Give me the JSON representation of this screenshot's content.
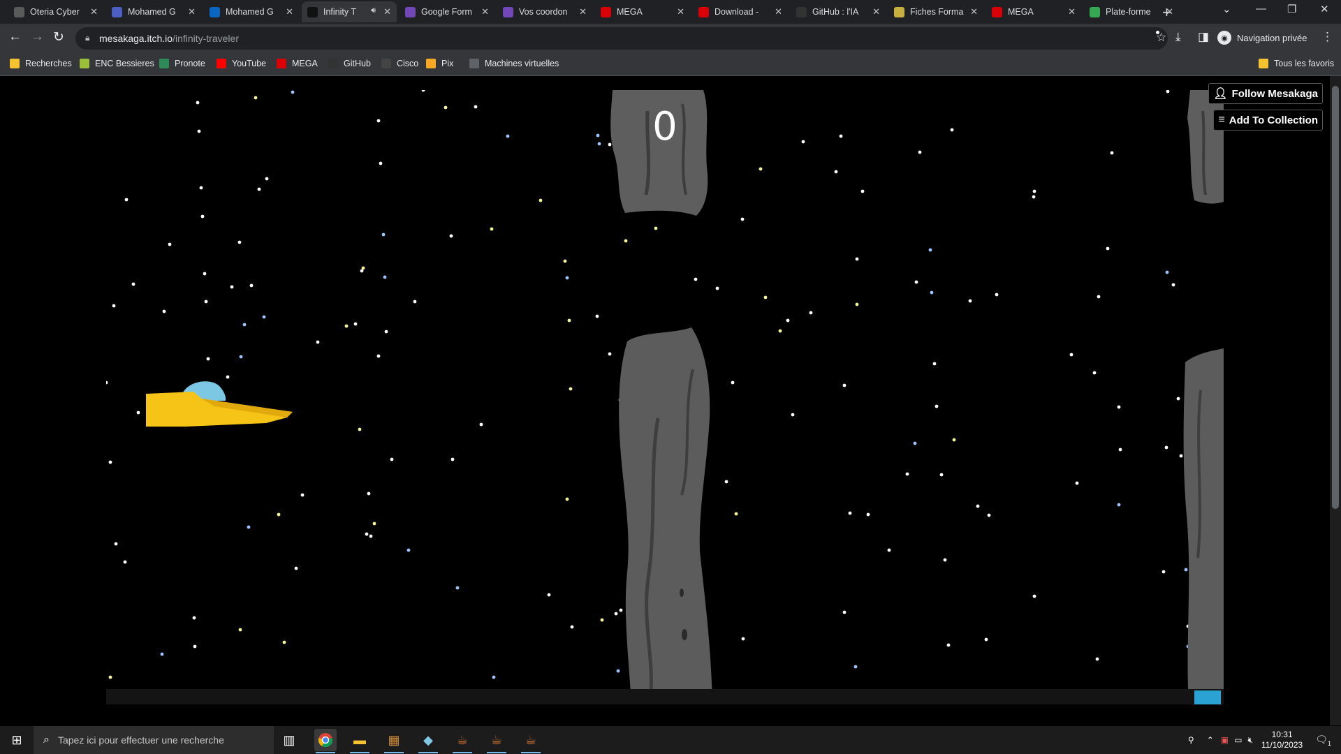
{
  "tabs": [
    {
      "title": "Oteria Cyber",
      "icon": "oteria-icon",
      "color": "#5a5a5a"
    },
    {
      "title": "Mohamed G",
      "icon": "calendar-icon",
      "color": "#4a5fc1"
    },
    {
      "title": "Mohamed G",
      "icon": "linkedin-icon",
      "color": "#0a66c2"
    },
    {
      "title": "Infinity T",
      "icon": "itch-icon",
      "color": "#111111",
      "active": true
    },
    {
      "title": "Google Form",
      "icon": "google-forms-icon",
      "color": "#7248b9"
    },
    {
      "title": "Vos coordon",
      "icon": "forms-icon",
      "color": "#7248b9"
    },
    {
      "title": "MEGA",
      "icon": "mega-icon",
      "color": "#d90007"
    },
    {
      "title": "Download -",
      "icon": "mega-icon",
      "color": "#d90007"
    },
    {
      "title": "GitHub : l'IA",
      "icon": "s-icon",
      "color": "#333333"
    },
    {
      "title": "Fiches Forma",
      "icon": "bookmark-icon",
      "color": "#c8b040"
    },
    {
      "title": "MEGA",
      "icon": "mega-icon",
      "color": "#d90007"
    },
    {
      "title": "Plate-forme",
      "icon": "drive-icon",
      "color": "#34a853"
    }
  ],
  "address": {
    "host": "mesakaga.itch.io",
    "path": "/infinity-traveler"
  },
  "incognito_label": "Navigation privée",
  "bookmarks": [
    {
      "label": "Recherches",
      "icon": "folder-icon",
      "color": "#f4c430"
    },
    {
      "label": "ENC Bessieres",
      "icon": "school-icon",
      "color": "#9bbf3a"
    },
    {
      "label": "Pronote",
      "icon": "pronote-icon",
      "color": "#2e8b57"
    },
    {
      "label": "YouTube",
      "icon": "youtube-icon",
      "color": "#ff0000"
    },
    {
      "label": "MEGA",
      "icon": "mega-icon",
      "color": "#d90007"
    },
    {
      "label": "GitHub",
      "icon": "github-icon",
      "color": "#333333"
    },
    {
      "label": "Cisco",
      "icon": "cisco-icon",
      "color": "#444444"
    },
    {
      "label": "Pix",
      "icon": "pix-icon",
      "color": "#f9a825"
    },
    {
      "label": "Machines virtuelles",
      "icon": "globe-icon",
      "color": "#5f6368"
    }
  ],
  "all_bookmarks_label": "Tous les favoris",
  "game": {
    "score": "0"
  },
  "itch": {
    "follow_label": "Follow Mesakaga",
    "collection_label": "Add To Collection"
  },
  "taskbar": {
    "search_placeholder": "Tapez ici pour effectuer une recherche",
    "time": "10:31",
    "date": "11/10/2023",
    "notifications": "1"
  }
}
